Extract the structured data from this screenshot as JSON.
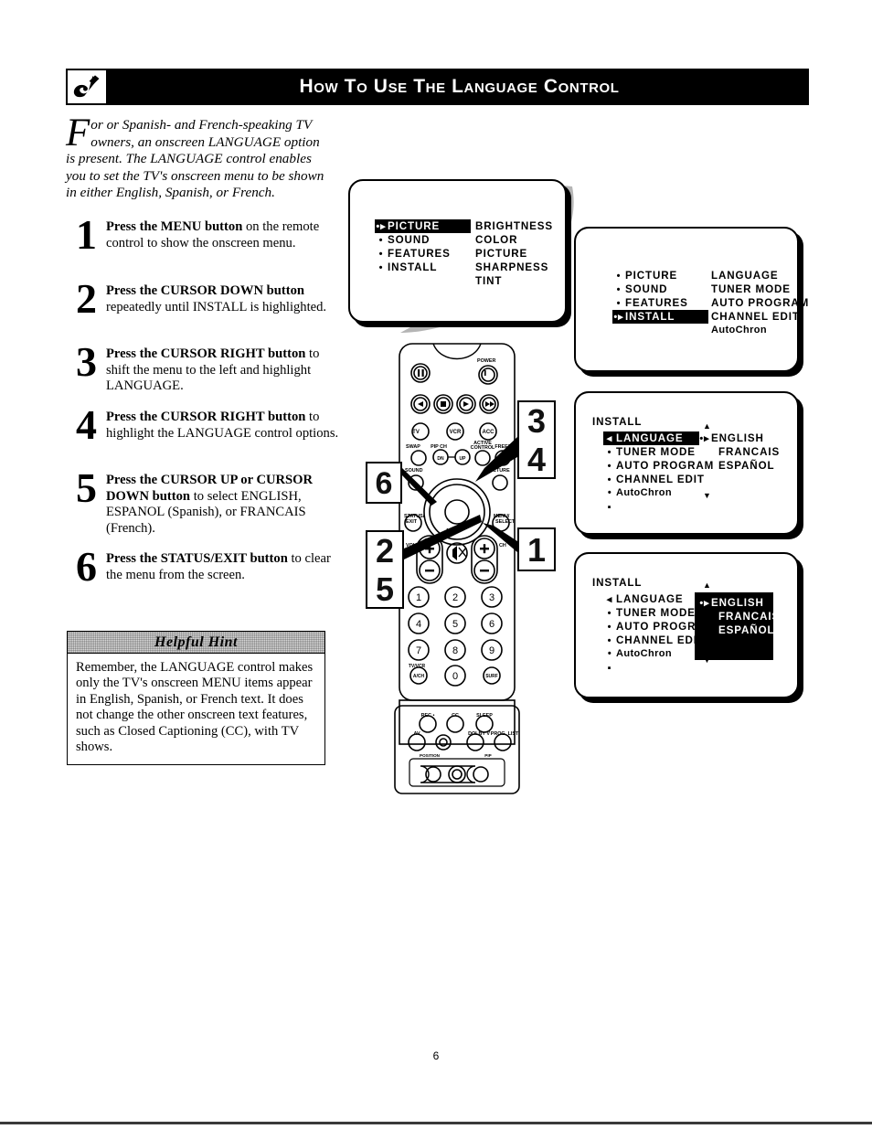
{
  "header": {
    "title": "How to Use the Language Control",
    "logo_icon": "philips-shield-icon"
  },
  "intro": {
    "dropcap": "F",
    "text": "or or Spanish- and French-speaking TV owners, an onscreen LANGUAGE option is present.  The LANGUAGE control enables you to set the TV's onscreen menu to be shown in either English, Spanish, or French."
  },
  "steps": [
    {
      "number": "1",
      "bold": "Press the MENU button",
      "rest": " on the remote control to show the onscreen menu."
    },
    {
      "number": "2",
      "bold": "Press the CURSOR DOWN button",
      "rest": " repeatedly until INSTALL is highlighted."
    },
    {
      "number": "3",
      "bold": "Press the CURSOR RIGHT button",
      "rest": " to shift the menu to the left and highlight LANGUAGE."
    },
    {
      "number": "4",
      "bold": "Press the CURSOR RIGHT button",
      "rest": " to highlight the LANGUAGE control options."
    },
    {
      "number": "5",
      "bold": "Press the CURSOR UP or CURSOR DOWN button",
      "rest": " to select ENGLISH, ESPANOL (Spanish), or FRANCAIS (French)."
    },
    {
      "number": "6",
      "bold": "Press the STATUS/EXIT button",
      "rest": " to clear the menu from the screen."
    }
  ],
  "hint": {
    "heading": "Helpful Hint",
    "body": "Remember, the LANGUAGE control makes only the TV's onscreen MENU items appear in English, Spanish, or French text. It does not change the other onscreen text features, such as Closed Captioning (CC), with TV shows."
  },
  "screens": {
    "screen1": {
      "left_items": [
        "PICTURE",
        "SOUND",
        "FEATURES",
        "INSTALL"
      ],
      "highlighted": "PICTURE",
      "right_items": [
        "BRIGHTNESS",
        "COLOR",
        "PICTURE",
        "SHARPNESS",
        "TINT"
      ]
    },
    "screen2": {
      "left_items": [
        "PICTURE",
        "SOUND",
        "FEATURES",
        "INSTALL"
      ],
      "highlighted": "INSTALL",
      "right_items": [
        "LANGUAGE",
        "TUNER MODE",
        "AUTO PROGRAM",
        "CHANNEL EDIT",
        "AutoChron"
      ]
    },
    "screen3": {
      "title": "INSTALL",
      "left_items": [
        "LANGUAGE",
        "TUNER MODE",
        "AUTO PROGRAM",
        "CHANNEL EDIT",
        "AutoChron"
      ],
      "highlighted": "LANGUAGE",
      "right_items": [
        "ENGLISH",
        "FRANCAIS",
        "ESPAÑOL"
      ],
      "selected_right": "ENGLISH",
      "scroll_up": "▲",
      "scroll_down": "▼"
    },
    "screen4": {
      "title": "INSTALL",
      "left_items": [
        "LANGUAGE",
        "TUNER MODE",
        "AUTO PROGRAM",
        "CHANNEL EDIT",
        "AutoChron"
      ],
      "highlighted": "LANGUAGE",
      "right_items": [
        "ENGLISH",
        "FRANCAIS",
        "ESPAÑOL"
      ],
      "selected_right": "ENGLISH",
      "options_block_highlighted": "true",
      "scroll_up": "▲",
      "scroll_down": "▼"
    }
  },
  "callouts": {
    "c34_top": "3",
    "c34_bottom": "4",
    "c1": "1",
    "c6": "6",
    "c25_top": "2",
    "c25_bottom": "5"
  },
  "remote": {
    "labels": {
      "power": "POWER",
      "tv": "TV",
      "vcr": "VCR",
      "acc": "ACC",
      "swap": "SWAP",
      "pip_ch": "PIP CH",
      "pip_dn": "DN",
      "pip_up": "UP",
      "active_control_line1": "ACTIVE",
      "active_control_line2": "CONTROL",
      "freeze": "FREEZE",
      "sound": "SOUND",
      "picture": "PICTURE",
      "status_exit_line1": "STATUS/",
      "status_exit_line2": "EXIT",
      "menu_select_line1": "MENU/",
      "menu_select_line2": "SELECT",
      "vol": "VOL",
      "ch": "CH",
      "mute": "MUTE",
      "tv_vcr_line1": "TV/VCR",
      "tv_vcr_line2": "A/CH",
      "surf": "SURF",
      "rec": "REC •",
      "cc": "CC",
      "sleep": "SLEEP",
      "av": "AV",
      "dolby": "DOLBY V",
      "prog_list": "PROG. LIST",
      "position": "POSITION",
      "pip": "PIP",
      "digits": [
        "1",
        "2",
        "3",
        "4",
        "5",
        "6",
        "7",
        "8",
        "9",
        "0"
      ]
    }
  },
  "footer": {
    "page_number": "6"
  }
}
